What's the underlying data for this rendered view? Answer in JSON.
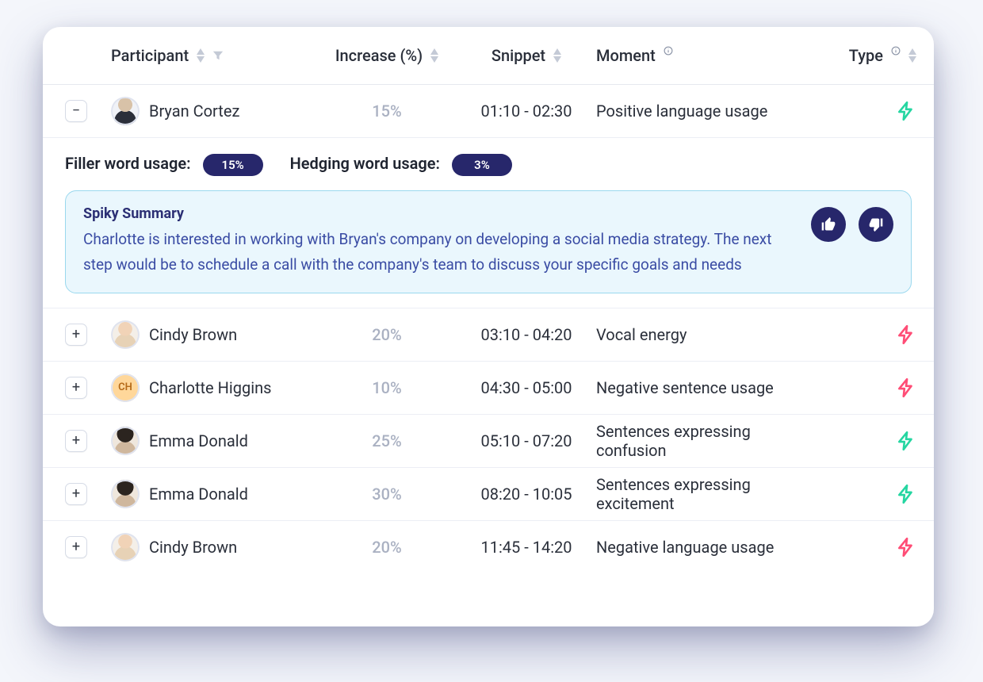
{
  "columns": {
    "participant": "Participant",
    "increase": "Increase (%)",
    "snippet": "Snippet",
    "moment": "Moment",
    "type": "Type"
  },
  "expanded": {
    "metrics": {
      "filler_label": "Filler word usage:",
      "filler_value": "15%",
      "hedging_label": "Hedging word usage:",
      "hedging_value": "3%"
    },
    "summary_title": "Spiky Summary",
    "summary_body": "Charlotte is interested in working with Bryan's company on developing a social media strategy. The next step would be to schedule a call with the company's team to discuss your specific goals and needs"
  },
  "rows": [
    {
      "toggle": "−",
      "name": "Bryan Cortez",
      "avatar": "bryan",
      "initials": "",
      "increase": "15%",
      "snippet": "01:10 - 02:30",
      "moment": "Positive language usage",
      "type": "green",
      "expanded": true
    },
    {
      "toggle": "+",
      "name": "Cindy Brown",
      "avatar": "cindy",
      "initials": "",
      "increase": "20%",
      "snippet": "03:10 - 04:20",
      "moment": "Vocal energy",
      "type": "pink"
    },
    {
      "toggle": "+",
      "name": "Charlotte Higgins",
      "avatar": "ch",
      "initials": "CH",
      "increase": "10%",
      "snippet": "04:30 - 05:00",
      "moment": "Negative sentence usage",
      "type": "pink"
    },
    {
      "toggle": "+",
      "name": "Emma Donald",
      "avatar": "emma",
      "initials": "",
      "increase": "25%",
      "snippet": "05:10 - 07:20",
      "moment": "Sentences expressing confusion",
      "type": "green"
    },
    {
      "toggle": "+",
      "name": "Emma Donald",
      "avatar": "emma",
      "initials": "",
      "increase": "30%",
      "snippet": "08:20 - 10:05",
      "moment": "Sentences expressing excitement",
      "type": "green"
    },
    {
      "toggle": "+",
      "name": "Cindy Brown",
      "avatar": "cindy",
      "initials": "",
      "increase": "20%",
      "snippet": "11:45 - 14:20",
      "moment": "Negative language usage",
      "type": "pink"
    }
  ]
}
